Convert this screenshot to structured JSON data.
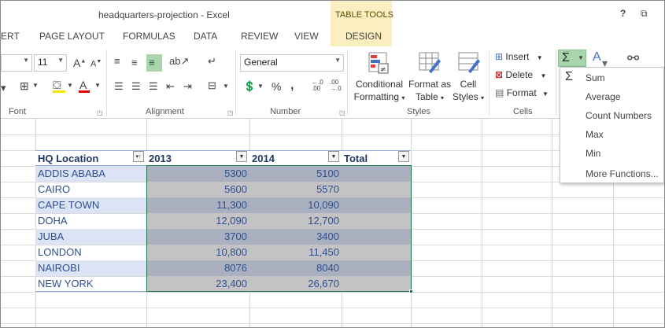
{
  "window": {
    "title": "headquarters-projection - Excel",
    "context_group": "TABLE TOOLS",
    "help_label": "?",
    "restore_label": "⧉"
  },
  "tabs": [
    "ERT",
    "PAGE LAYOUT",
    "FORMULAS",
    "DATA",
    "REVIEW",
    "VIEW",
    "DESIGN"
  ],
  "ribbon": {
    "font": {
      "size": "11",
      "grow": "A",
      "shrink": "A",
      "label": "Font"
    },
    "alignment": {
      "label": "Alignment"
    },
    "number": {
      "format": "General",
      "percent": "%",
      "comma": ",",
      "inc_decimal": "←.0\n.00",
      "dec_decimal": ".00\n→.0",
      "label": "Number"
    },
    "styles": {
      "conditional_l1": "Conditional",
      "conditional_l2": "Formatting",
      "format_table_l1": "Format as",
      "format_table_l2": "Table",
      "cell_styles_l1": "Cell",
      "cell_styles_l2": "Styles",
      "label": "Styles"
    },
    "cells": {
      "insert": "Insert",
      "delete": "Delete",
      "format": "Format",
      "label": "Cells"
    }
  },
  "autosum_menu": {
    "items": [
      "Sum",
      "Average",
      "Count Numbers",
      "Max",
      "Min",
      "More Functions..."
    ]
  },
  "table": {
    "headers": [
      "HQ Location",
      "2013",
      "2014",
      "Total"
    ],
    "rows": [
      [
        "ADDIS ABABA",
        "5300",
        "5100",
        ""
      ],
      [
        "CAIRO",
        "5600",
        "5570",
        ""
      ],
      [
        "CAPE TOWN",
        "11,300",
        "10,090",
        ""
      ],
      [
        "DOHA",
        "12,090",
        "12,700",
        ""
      ],
      [
        "JUBA",
        "3700",
        "3400",
        ""
      ],
      [
        "LONDON",
        "10,800",
        "11,450",
        ""
      ],
      [
        "NAIROBI",
        "8076",
        "8040",
        ""
      ],
      [
        "NEW YORK",
        "23,400",
        "26,670",
        ""
      ]
    ]
  },
  "colors": {
    "accent_green": "#217346",
    "selection_dark": "#aab0bf",
    "selection_light": "#c3c3c5",
    "band": "#dbe3f4",
    "context_tab": "#fbeec0"
  }
}
